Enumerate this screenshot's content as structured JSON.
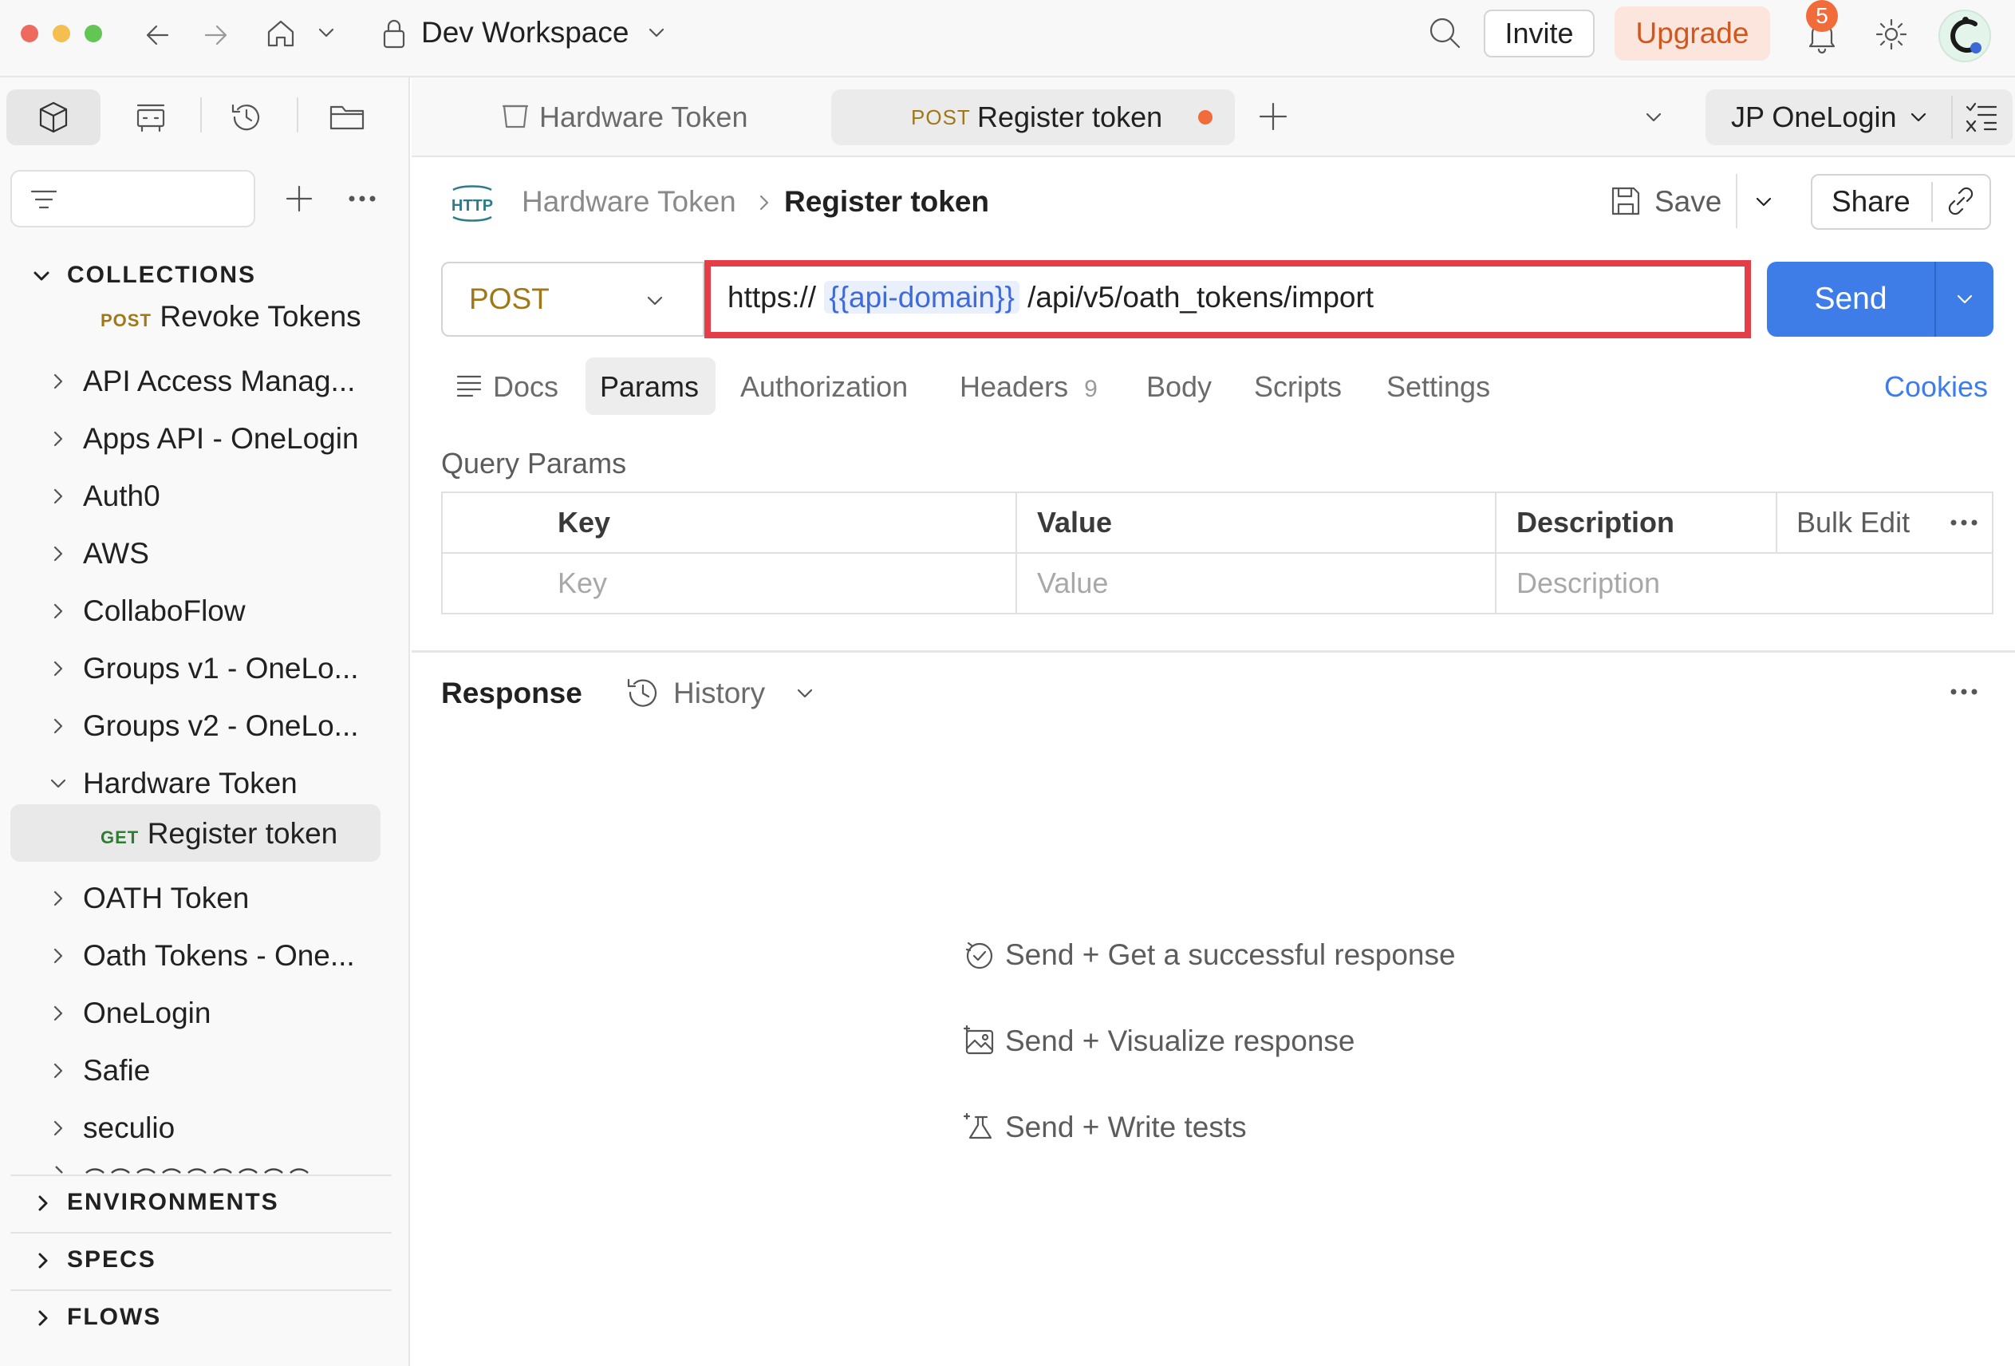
{
  "titlebar": {
    "workspace": "Dev Workspace",
    "invite_label": "Invite",
    "upgrade_label": "Upgrade",
    "notification_count": "5"
  },
  "sidebar": {
    "collections_label": "COLLECTIONS",
    "revoke": {
      "method": "POST",
      "label": "Revoke Tokens"
    },
    "items": [
      {
        "label": "API Access Manag...",
        "expanded": false
      },
      {
        "label": "Apps API - OneLogin",
        "expanded": false
      },
      {
        "label": "Auth0",
        "expanded": false
      },
      {
        "label": "AWS",
        "expanded": false
      },
      {
        "label": "CollaboFlow",
        "expanded": false
      },
      {
        "label": "Groups v1 - OneLo...",
        "expanded": false
      },
      {
        "label": "Groups v2 - OneLo...",
        "expanded": false
      },
      {
        "label": "Hardware Token",
        "expanded": true
      },
      {
        "label": "OATH Token",
        "expanded": false
      },
      {
        "label": "Oath Tokens - One...",
        "expanded": false
      },
      {
        "label": "OneLogin",
        "expanded": false
      },
      {
        "label": "Safie",
        "expanded": false
      },
      {
        "label": "seculio",
        "expanded": false
      }
    ],
    "child": {
      "method": "GET",
      "label": "Register token"
    },
    "environments_label": "ENVIRONMENTS",
    "specs_label": "SPECS",
    "flows_label": "FLOWS"
  },
  "tabs": {
    "tab1_label": "Hardware Token",
    "tab2_method": "POST",
    "tab2_label": "Register token",
    "environment": "JP OneLogin"
  },
  "request": {
    "breadcrumb_parent": "Hardware Token",
    "breadcrumb_current": "Register token",
    "http_icon_text": "HTTP",
    "save_label": "Save",
    "share_label": "Share",
    "method": "POST",
    "url_prefix": "https://",
    "url_variable": "{{api-domain}}",
    "url_suffix": "/api/v5/oath_tokens/import",
    "send_label": "Send",
    "subtabs": {
      "docs": "Docs",
      "params": "Params",
      "authorization": "Authorization",
      "headers": "Headers",
      "headers_count": "9",
      "body": "Body",
      "scripts": "Scripts",
      "settings": "Settings",
      "cookies": "Cookies"
    }
  },
  "params": {
    "title": "Query Params",
    "col_key": "Key",
    "col_value": "Value",
    "col_description": "Description",
    "bulk_edit": "Bulk Edit",
    "ph_key": "Key",
    "ph_value": "Value",
    "ph_description": "Description"
  },
  "response": {
    "title": "Response",
    "history_label": "History",
    "hints": [
      "Send + Get a successful response",
      "Send + Visualize response",
      "Send + Write tests"
    ]
  },
  "colors": {
    "accent_blue": "#3e7de8",
    "post_method": "#a0781a",
    "get_method": "#2e7d32",
    "highlight_red": "#e43e48",
    "upgrade_orange": "#d0581f"
  }
}
